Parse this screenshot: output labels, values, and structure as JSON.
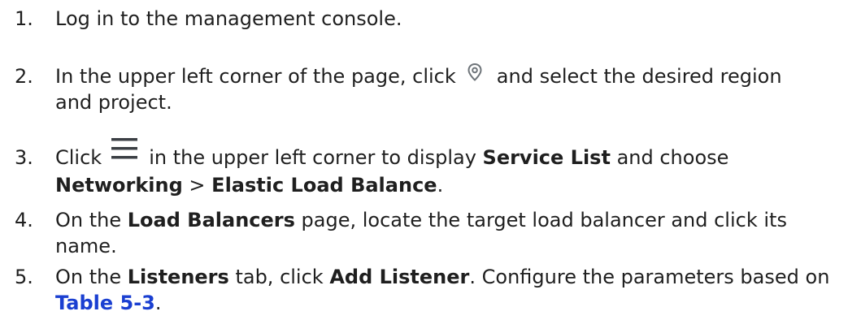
{
  "steps": [
    {
      "number": "1.",
      "text": "Log in to the management console."
    },
    {
      "number": "2.",
      "before_icon": "In the upper left corner of the page, click",
      "icon": "location-pin-icon",
      "after_icon": "and select the desired region",
      "line2": "and project."
    },
    {
      "number": "3.",
      "before_icon": "Click",
      "icon": "hamburger-menu-icon",
      "after_icon_a": "in the upper left corner to display",
      "bold1": "Service List",
      "after_bold1": "and choose",
      "bold2": "Networking",
      "separator": " > ",
      "bold3": "Elastic Load Balance",
      "end": "."
    },
    {
      "number": "4.",
      "a": "On the",
      "bold1": "Load Balancers",
      "b": "page, locate the target load balancer and click its",
      "line2": "name."
    },
    {
      "number": "5.",
      "a": "On the",
      "bold1": "Listeners",
      "b": "tab, click",
      "bold2": "Add Listener",
      "c": ". Configure the parameters based on",
      "link": "Table 5-3",
      "end": "."
    }
  ],
  "colors": {
    "text": "#1f1f1f",
    "link": "#1a3fd1",
    "icon": "#6e7479",
    "menu_icon": "#3b3f44"
  }
}
